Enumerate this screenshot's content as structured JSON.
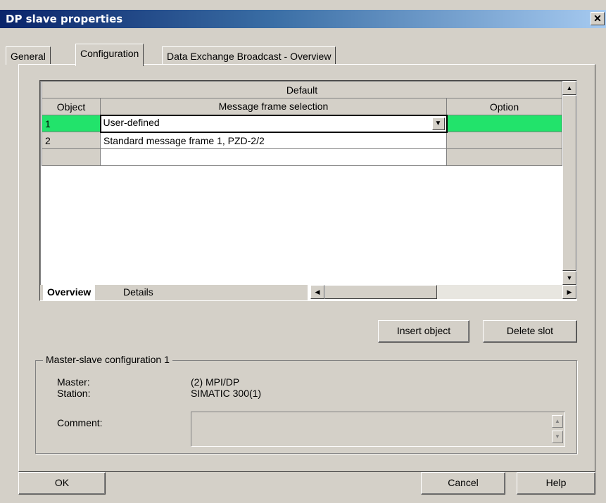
{
  "window": {
    "title": "DP slave properties",
    "close_glyph": "✕"
  },
  "tabs": [
    {
      "label": "General"
    },
    {
      "label": "Configuration"
    },
    {
      "label": "Data Exchange Broadcast - Overview"
    }
  ],
  "grid": {
    "group_header": "Default",
    "columns": [
      "Object",
      "Message frame selection",
      "Option"
    ],
    "rows": [
      {
        "object": "1",
        "selection": "User-defined",
        "option": ""
      },
      {
        "object": "2",
        "selection": "Standard message frame 1, PZD-2/2",
        "option": ""
      },
      {
        "object": "",
        "selection": "",
        "option": ""
      }
    ],
    "sheet_tabs": [
      "Overview",
      "Details"
    ],
    "highlight_color": "#22e36b"
  },
  "buttons": {
    "insert_object": "Insert object",
    "delete_slot": "Delete slot",
    "ok": "OK",
    "cancel": "Cancel",
    "help": "Help"
  },
  "master_slave": {
    "group_title": "Master-slave configuration 1",
    "master_label": "Master:",
    "master_value": "(2) MPI/DP",
    "station_label": "Station:",
    "station_value": "SIMATIC 300(1)",
    "comment_label": "Comment:",
    "comment_value": ""
  }
}
